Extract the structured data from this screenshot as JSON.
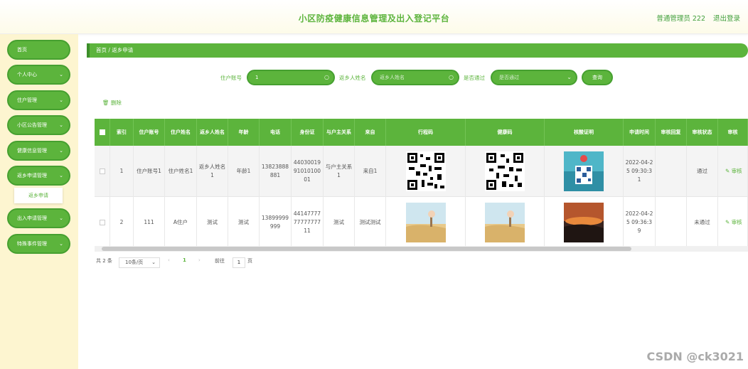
{
  "header": {
    "title": "小区防疫健康信息管理及出入登记平台",
    "user": "普通管理员 222",
    "logout": "退出登录"
  },
  "sidebar": {
    "items": [
      {
        "label": "首页",
        "arrow": ""
      },
      {
        "label": "个人中心",
        "arrow": "⌄"
      },
      {
        "label": "住户管理",
        "arrow": "⌄"
      },
      {
        "label": "小区公告管理",
        "arrow": "⌄"
      },
      {
        "label": "健康信息管理",
        "arrow": "⌄"
      },
      {
        "label": "返乡申请管理",
        "arrow": "⌄"
      },
      {
        "label": "出入申请管理",
        "arrow": "⌄"
      },
      {
        "label": "特殊事件管理",
        "arrow": "⌄"
      }
    ],
    "submenu": "返乡申请"
  },
  "breadcrumb": "首页 / 返乡申请",
  "search": {
    "account_label": "住户账号",
    "account_value": "1",
    "name_label": "返乡人姓名",
    "name_placeholder": "返乡人姓名",
    "pass_label": "是否通过",
    "pass_placeholder": "是否通过",
    "query": "查询"
  },
  "delete": "删除",
  "table": {
    "headers": [
      "索引",
      "住户账号",
      "住户姓名",
      "返乡人姓名",
      "年龄",
      "电话",
      "身份证",
      "与户主关系",
      "来自",
      "行程码",
      "健康码",
      "核酸证明",
      "申请时间",
      "审核回复",
      "审核状态",
      "审核"
    ],
    "rows": [
      {
        "index": "1",
        "account": "住户账号1",
        "name": "住户姓名1",
        "returnee": "返乡人姓名1",
        "age": "年龄1",
        "phone": "13823888881",
        "idcard": "440300199101010001",
        "relation": "与户主关系1",
        "from": "来自1",
        "time": "2022-04-25 09:30:31",
        "reply": "",
        "status": "通过",
        "action": "审核"
      },
      {
        "index": "2",
        "account": "111",
        "name": "A住户",
        "returnee": "测试",
        "age": "测试",
        "phone": "13899999999",
        "idcard": "441477777777777711",
        "relation": "测试",
        "from": "测试测试",
        "time": "2022-04-25 09:36:39",
        "reply": "",
        "status": "未通过",
        "action": "审核"
      }
    ]
  },
  "pager": {
    "total": "共 2 条",
    "size": "10条/页",
    "page": "1",
    "goto": "前往",
    "goto_val": "1",
    "unit": "页"
  },
  "watermark": "CSDN @ck3021"
}
